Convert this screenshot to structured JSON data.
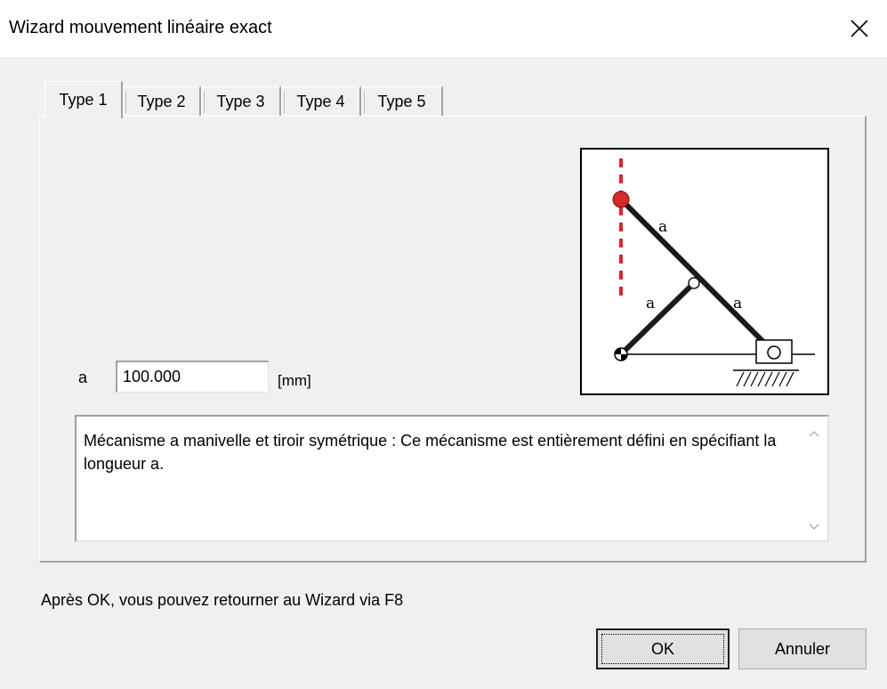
{
  "window": {
    "title": "Wizard mouvement linéaire exact",
    "close_icon": "close-icon"
  },
  "tabs": [
    {
      "label": "Type 1",
      "active": true
    },
    {
      "label": "Type 2",
      "active": false
    },
    {
      "label": "Type 3",
      "active": false
    },
    {
      "label": "Type 4",
      "active": false
    },
    {
      "label": "Type 5",
      "active": false
    }
  ],
  "parameter": {
    "label": "a",
    "value": "100.000",
    "unit": "[mm]"
  },
  "diagram": {
    "link_labels": [
      "a",
      "a",
      "a"
    ],
    "colors": {
      "path": "#d42a2a",
      "point": "#d42a2a",
      "link": "#1a1a1a"
    }
  },
  "description": "Mécanisme a manivelle et tiroir symétrique : Ce mécanisme est entièrement défini en spécifiant la longueur a.",
  "info": "Après OK, vous pouvez retourner au Wizard via F8",
  "buttons": {
    "ok": "OK",
    "cancel": "Annuler"
  }
}
